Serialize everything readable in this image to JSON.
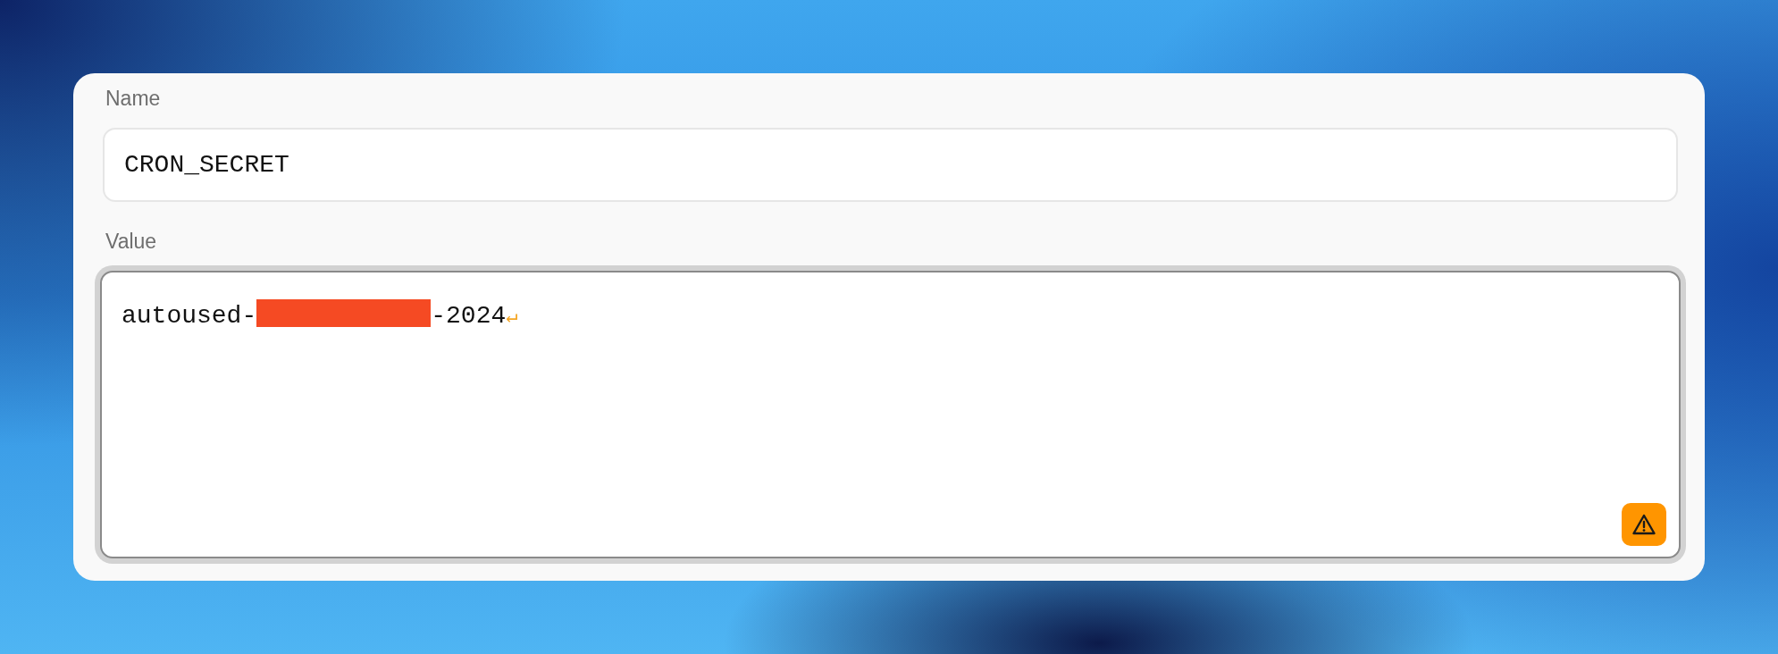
{
  "fields": [
    {
      "kind": "input",
      "label": "Name",
      "value_parts": [
        {
          "kind": "text",
          "text": "CRON_SECRET"
        }
      ]
    },
    {
      "kind": "textarea",
      "label": "Value",
      "value_parts": [
        {
          "kind": "text",
          "text": "autoused-"
        },
        {
          "kind": "redaction"
        },
        {
          "kind": "text",
          "text": "-2024"
        }
      ],
      "newline_marker": "↵",
      "focused": true,
      "warning": true
    }
  ]
}
